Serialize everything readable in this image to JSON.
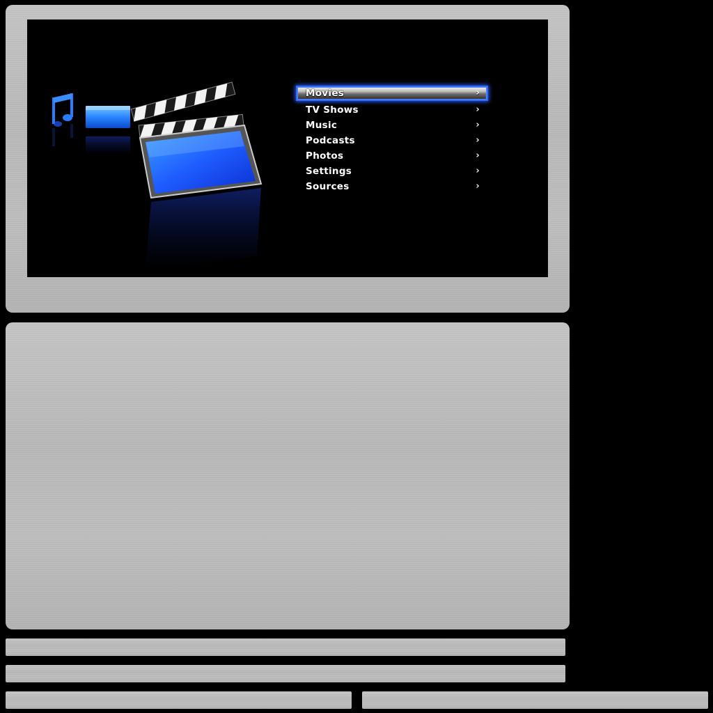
{
  "menu": {
    "items": [
      {
        "label": "Movies",
        "selected": true
      },
      {
        "label": "TV Shows",
        "selected": false
      },
      {
        "label": "Music",
        "selected": false
      },
      {
        "label": "Podcasts",
        "selected": false
      },
      {
        "label": "Photos",
        "selected": false
      },
      {
        "label": "Settings",
        "selected": false
      },
      {
        "label": "Sources",
        "selected": false
      }
    ],
    "chevron": "›",
    "accent_color": "#2f6bff"
  },
  "icons": {
    "main": "clapperboard-icon",
    "secondary": [
      "music-note-icon",
      "tv-screen-icon"
    ]
  }
}
